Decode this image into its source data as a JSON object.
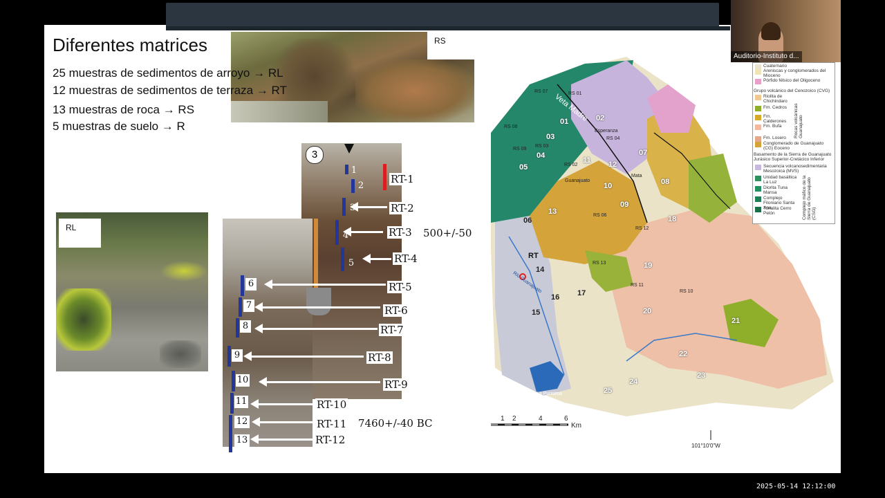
{
  "meeting": {
    "participant_name": "Auditorio-Instituto d...",
    "timestamp": "2025-05-14 12:12:00"
  },
  "slide": {
    "title": "Diferentes matrices",
    "bullets": [
      "25 muestras de sedimentos de arroyo → RL",
      "12 muestras de sedimentos de terraza → RT",
      "13 muestras de roca → RS",
      "5 muestras de suelo → R"
    ],
    "photo_rs_label": "RS",
    "photo_rl_label": "RL",
    "profile": {
      "marker": "3",
      "samples": [
        "RT-1",
        "RT-2",
        "RT-3",
        "RT-4",
        "RT-5",
        "RT-6",
        "RT-7",
        "RT-8",
        "RT-9",
        "RT-10",
        "RT-11",
        "RT-12"
      ],
      "depth_numbers": [
        "1",
        "2",
        "3",
        "4",
        "5",
        "6",
        "7",
        "8",
        "9",
        "10",
        "11",
        "12",
        "13"
      ],
      "date_rt3": "500+/-50",
      "date_rt11": "7460+/-40 BC"
    },
    "map": {
      "scale_ticks": [
        "1",
        "2",
        "4",
        "6"
      ],
      "scale_unit": "Km",
      "longitude": "101°10'0\"W",
      "river_label": "Río Guanajuato",
      "vein_label": "Veta Madre",
      "site_numbers": [
        "01",
        "02",
        "03",
        "04",
        "05",
        "06",
        "07",
        "08",
        "09",
        "10",
        "11",
        "12",
        "13",
        "14",
        "15",
        "16",
        "17",
        "18",
        "19",
        "20",
        "21",
        "22",
        "23",
        "24",
        "25"
      ],
      "rs_labels": [
        "RS 01",
        "RS 02",
        "RS 03",
        "RS 04",
        "RS 06",
        "RS 07",
        "RS 08",
        "RS 09",
        "RS 10",
        "RS 11",
        "RS 12",
        "RS 13"
      ],
      "town_labels": [
        "Guanajuato",
        "Esperanza",
        "Mata",
        "La Purisima"
      ],
      "rt_label": "RT",
      "legend": [
        {
          "label": "Cuaternario",
          "color": "#e8e4d0"
        },
        {
          "label": "Areniscas y conglomerados del Mioceno",
          "color": "#efe3b8"
        },
        {
          "label": "Pórfido félsico del Oligoceno",
          "color": "#e8a0c8"
        },
        {
          "label": "Grupo volcánico del Cenozoico (CVG)",
          "color": ""
        },
        {
          "label": "Riolita de Chichindaro",
          "color": "#f0c890"
        },
        {
          "label": "Fm. Cedros",
          "color": "#8fae2a"
        },
        {
          "label": "Fm. Calderones",
          "color": "#d6a92a"
        },
        {
          "label": "Fm. Bufa",
          "color": "#f2b8a0"
        },
        {
          "label": "Rocas volcánicas Guanajuato",
          "color": ""
        },
        {
          "label": "Fm. Losero",
          "color": "#e3a88c"
        },
        {
          "label": "Conglomerado de Guanajuato (CG) Eoceno",
          "color": "#d4a43a"
        },
        {
          "label": "Basamento de la Sierra de Guanajuato Jurásico Superior-Cretácico Inferior",
          "color": ""
        },
        {
          "label": "Secuencia volcanosedimentaria Mesozoica (MVS)",
          "color": "#c8b8e0"
        },
        {
          "label": "Unidad basáltica La Luz",
          "color": "#2f8f5f"
        },
        {
          "label": "Diorita Tuna Mansa",
          "color": "#239060"
        },
        {
          "label": "Complejo Filoniano Santa Ana",
          "color": "#1d7f55"
        },
        {
          "label": "Tonalita Cerro Pelón",
          "color": "#197048"
        },
        {
          "label": "Complejo máfico de la Sierra de Guanajuato (CSG)",
          "color": ""
        }
      ]
    }
  }
}
